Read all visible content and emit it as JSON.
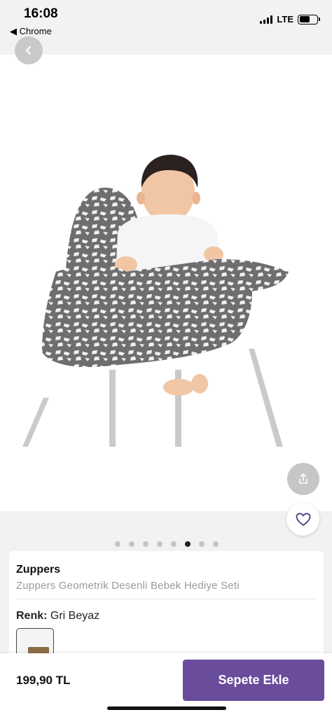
{
  "status_bar": {
    "time": "16:08",
    "back_app": "◀ Chrome",
    "network": "LTE",
    "battery_level": 0.62
  },
  "header": {
    "back_icon": "chevron-left-icon"
  },
  "gallery": {
    "image_description_icon": "product-photo",
    "page_count": 8,
    "active_index": 5,
    "share_icon": "share-icon",
    "favorite_icon": "heart-icon"
  },
  "product": {
    "brand": "Zuppers",
    "name": "Zuppers Geometrik Desenli Bebek Hediye Seti",
    "color_label": "Renk:",
    "color_value": "Gri Beyaz"
  },
  "bottom_bar": {
    "price": "199,90 TL",
    "cart_button": "Sepete Ekle"
  },
  "colors": {
    "accent": "#6a4c9c",
    "pattern_gray": "#6e6e70"
  }
}
